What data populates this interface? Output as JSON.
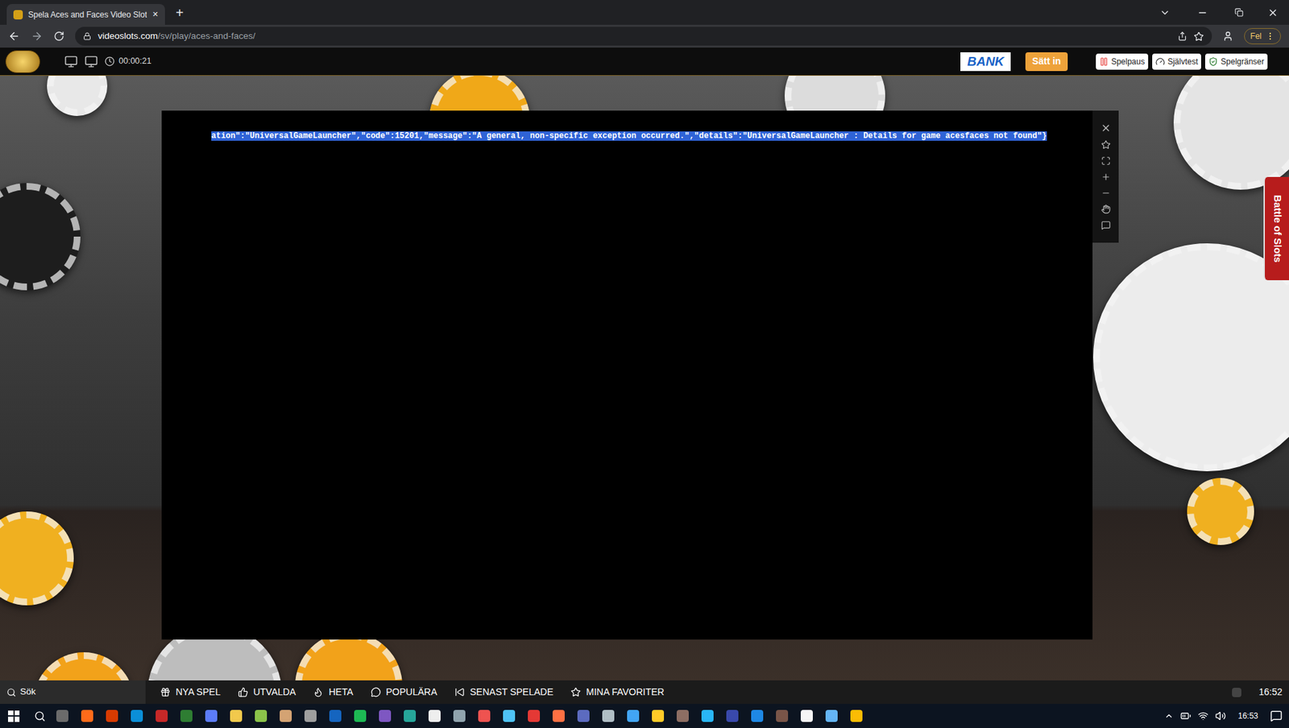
{
  "browser": {
    "tab": {
      "title": "Spela Aces and Faces Video Slot",
      "close": "✕"
    },
    "new_tab": "+",
    "url": {
      "host": "videoslots.com",
      "path": "/sv/play/aces-and-faces/"
    },
    "profile_badge": "Fel"
  },
  "site_header": {
    "timer": "00:00:21",
    "bank": "BANK",
    "deposit": "Sätt in",
    "tools": [
      {
        "label": "Spelpaus"
      },
      {
        "label": "Självtest"
      },
      {
        "label": "Spelgränser"
      }
    ]
  },
  "game": {
    "error_text": "ation\":\"UniversalGameLauncher\",\"code\":15201,\"message\":\"A general, non-specific exception occurred.\",\"details\":\"UniversalGameLauncher : Details for game acesfaces not found\"}",
    "selected": true
  },
  "side_tab": {
    "label": "Battle of Slots"
  },
  "bottom_nav": {
    "search": "Sök",
    "items": [
      {
        "label": "NYA SPEL"
      },
      {
        "label": "UTVALDA"
      },
      {
        "label": "HETA"
      },
      {
        "label": "POPULÄRA"
      },
      {
        "label": "SENAST SPELADE"
      },
      {
        "label": "MINA FAVORITER"
      }
    ],
    "time": "16:52"
  },
  "taskbar": {
    "time": "16:53"
  }
}
